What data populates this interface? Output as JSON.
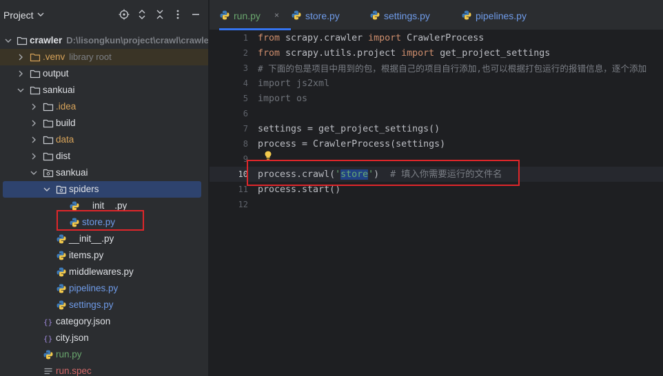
{
  "project_panel": {
    "title": "Project",
    "tree": [
      {
        "label": "crawler",
        "hint": "D:\\lisongkun\\project\\crawl\\crawler"
      },
      {
        "label": ".venv",
        "hint": "library root"
      },
      {
        "label": "output"
      },
      {
        "label": "sankuai"
      },
      {
        "label": ".idea"
      },
      {
        "label": "build"
      },
      {
        "label": "data"
      },
      {
        "label": "dist"
      },
      {
        "label": "sankuai"
      },
      {
        "label": "spiders"
      },
      {
        "label": "__init__.py"
      },
      {
        "label": "store.py"
      },
      {
        "label": "__init__.py"
      },
      {
        "label": "items.py"
      },
      {
        "label": "middlewares.py"
      },
      {
        "label": "pipelines.py"
      },
      {
        "label": "settings.py"
      },
      {
        "label": "category.json"
      },
      {
        "label": "city.json"
      },
      {
        "label": "run.py"
      },
      {
        "label": "run.spec"
      }
    ]
  },
  "tabs": [
    {
      "label": "run.py",
      "close": "×"
    },
    {
      "label": "store.py"
    },
    {
      "label": "settings.py"
    },
    {
      "label": "pipelines.py"
    }
  ],
  "editor": {
    "line_numbers": [
      "1",
      "2",
      "3",
      "4",
      "5",
      "6",
      "7",
      "8",
      "9",
      "10",
      "11",
      "12"
    ],
    "lines": {
      "l1": {
        "kw1": "from",
        "t1": " scrapy.crawler ",
        "kw2": "import",
        "t2": " CrawlerProcess"
      },
      "l2": {
        "kw1": "from",
        "t1": " scrapy.utils.project ",
        "kw2": "import",
        "t2": " get_project_settings"
      },
      "l3": {
        "comment": "# 下面的包是项目中用到的包，根据自己的项目自行添加,也可以根据打包运行的报错信息，逐个添加"
      },
      "l4": {
        "text": "import js2xml"
      },
      "l5": {
        "text": "import os"
      },
      "l7": {
        "text": "settings = get_project_settings()"
      },
      "l8": {
        "text": "process = CrawlerProcess(settings)"
      },
      "l10": {
        "t1": "process.crawl(",
        "q1": "'",
        "sel": "store",
        "q2": "'",
        "t2": ")  ",
        "comment": "# 填入你需要运行的文件名"
      },
      "l11": {
        "text": "process.start()"
      }
    }
  },
  "colors": {
    "accent": "#3574f0",
    "annotation": "#e0262a",
    "keyword": "#cf8e6d",
    "string": "#6aab73",
    "comment": "#7a7e85"
  }
}
